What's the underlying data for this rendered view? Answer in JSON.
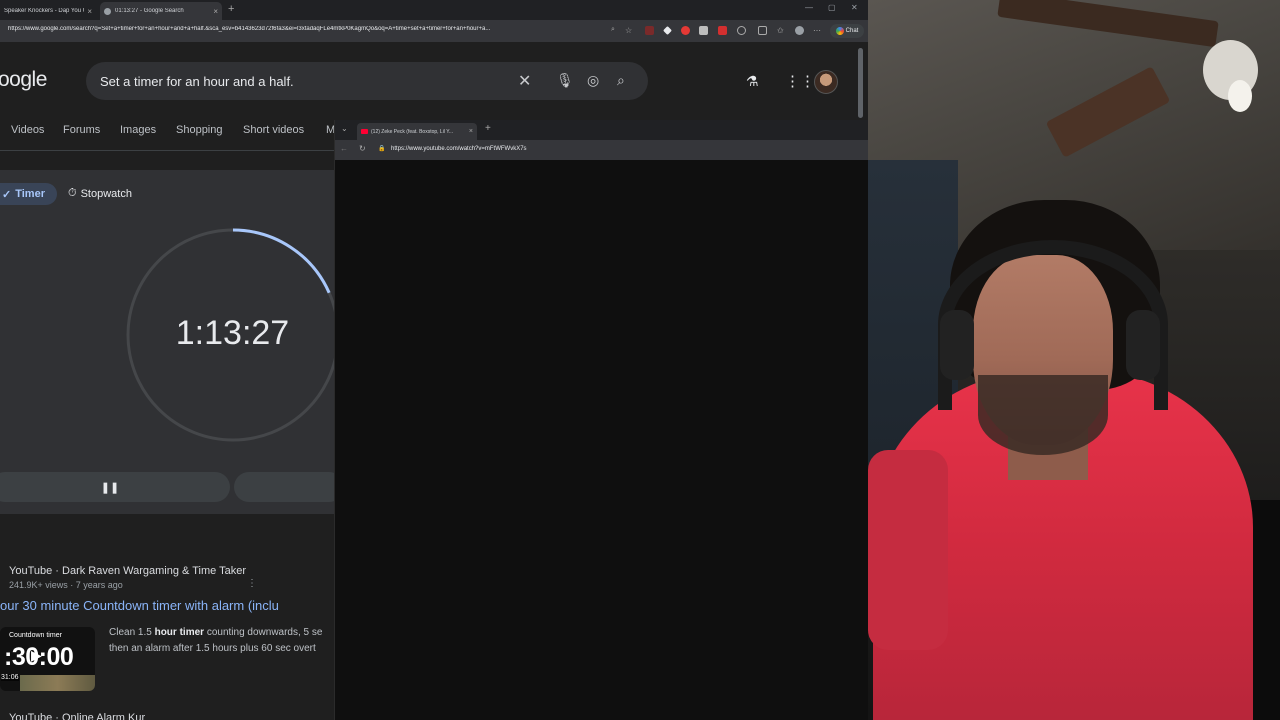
{
  "browser": {
    "tabs": [
      {
        "title": "Speaker Knockers - Dap You Up",
        "active": false
      },
      {
        "title": "01:13:27 - Google Search",
        "active": true
      }
    ],
    "url": "https://www.google.com/search?q=Set+a+timer+for+an+hour+and+a+half.&sca_esv=b4143623d72f6fa3&ei=l3xtadaqFLe4mtkP0KagmQo&oq=A+time+set+a+timer+for+an+hour+a...",
    "chat_label": "Chat"
  },
  "google": {
    "logo": "oogle",
    "query": "Set a timer for an hour and a half.",
    "nav": [
      "Videos",
      "Forums",
      "Images",
      "Shopping",
      "Short videos",
      "M"
    ],
    "timer": {
      "tab_timer": "Timer",
      "tab_stopwatch": "Stopwatch",
      "remaining": "1:13:27",
      "progress_remaining": 0.816
    },
    "result": {
      "source": "YouTube · Dark Raven Wargaming & Time Taker",
      "meta": "241.9K+ views · 7 years ago",
      "title": "our 30 minute Countdown timer with alarm (inclu",
      "thumb_label": "Countdown timer",
      "thumb_time": ":30:00",
      "thumb_duration": "31:06",
      "snippet_line1_a": "Clean 1.5 ",
      "snippet_line1_b": "hour timer",
      "snippet_line1_c": " counting downwards, 5 se",
      "snippet_line2": "then an alarm after 1.5 hours plus 60 sec overt"
    },
    "next_result": "YouTube · Online Alarm Kur"
  },
  "overlay": {
    "tab_title": "(12) Zeke Peck (feat. Boxstop, Lil Y...",
    "url": "https://www.youtube.com/watch?v=mFtWFWvkX7s"
  },
  "colors": {
    "accent_blue": "#8ab4f8",
    "timer_ring": "#a8c7fa",
    "shirt_red": "#e8334a"
  }
}
